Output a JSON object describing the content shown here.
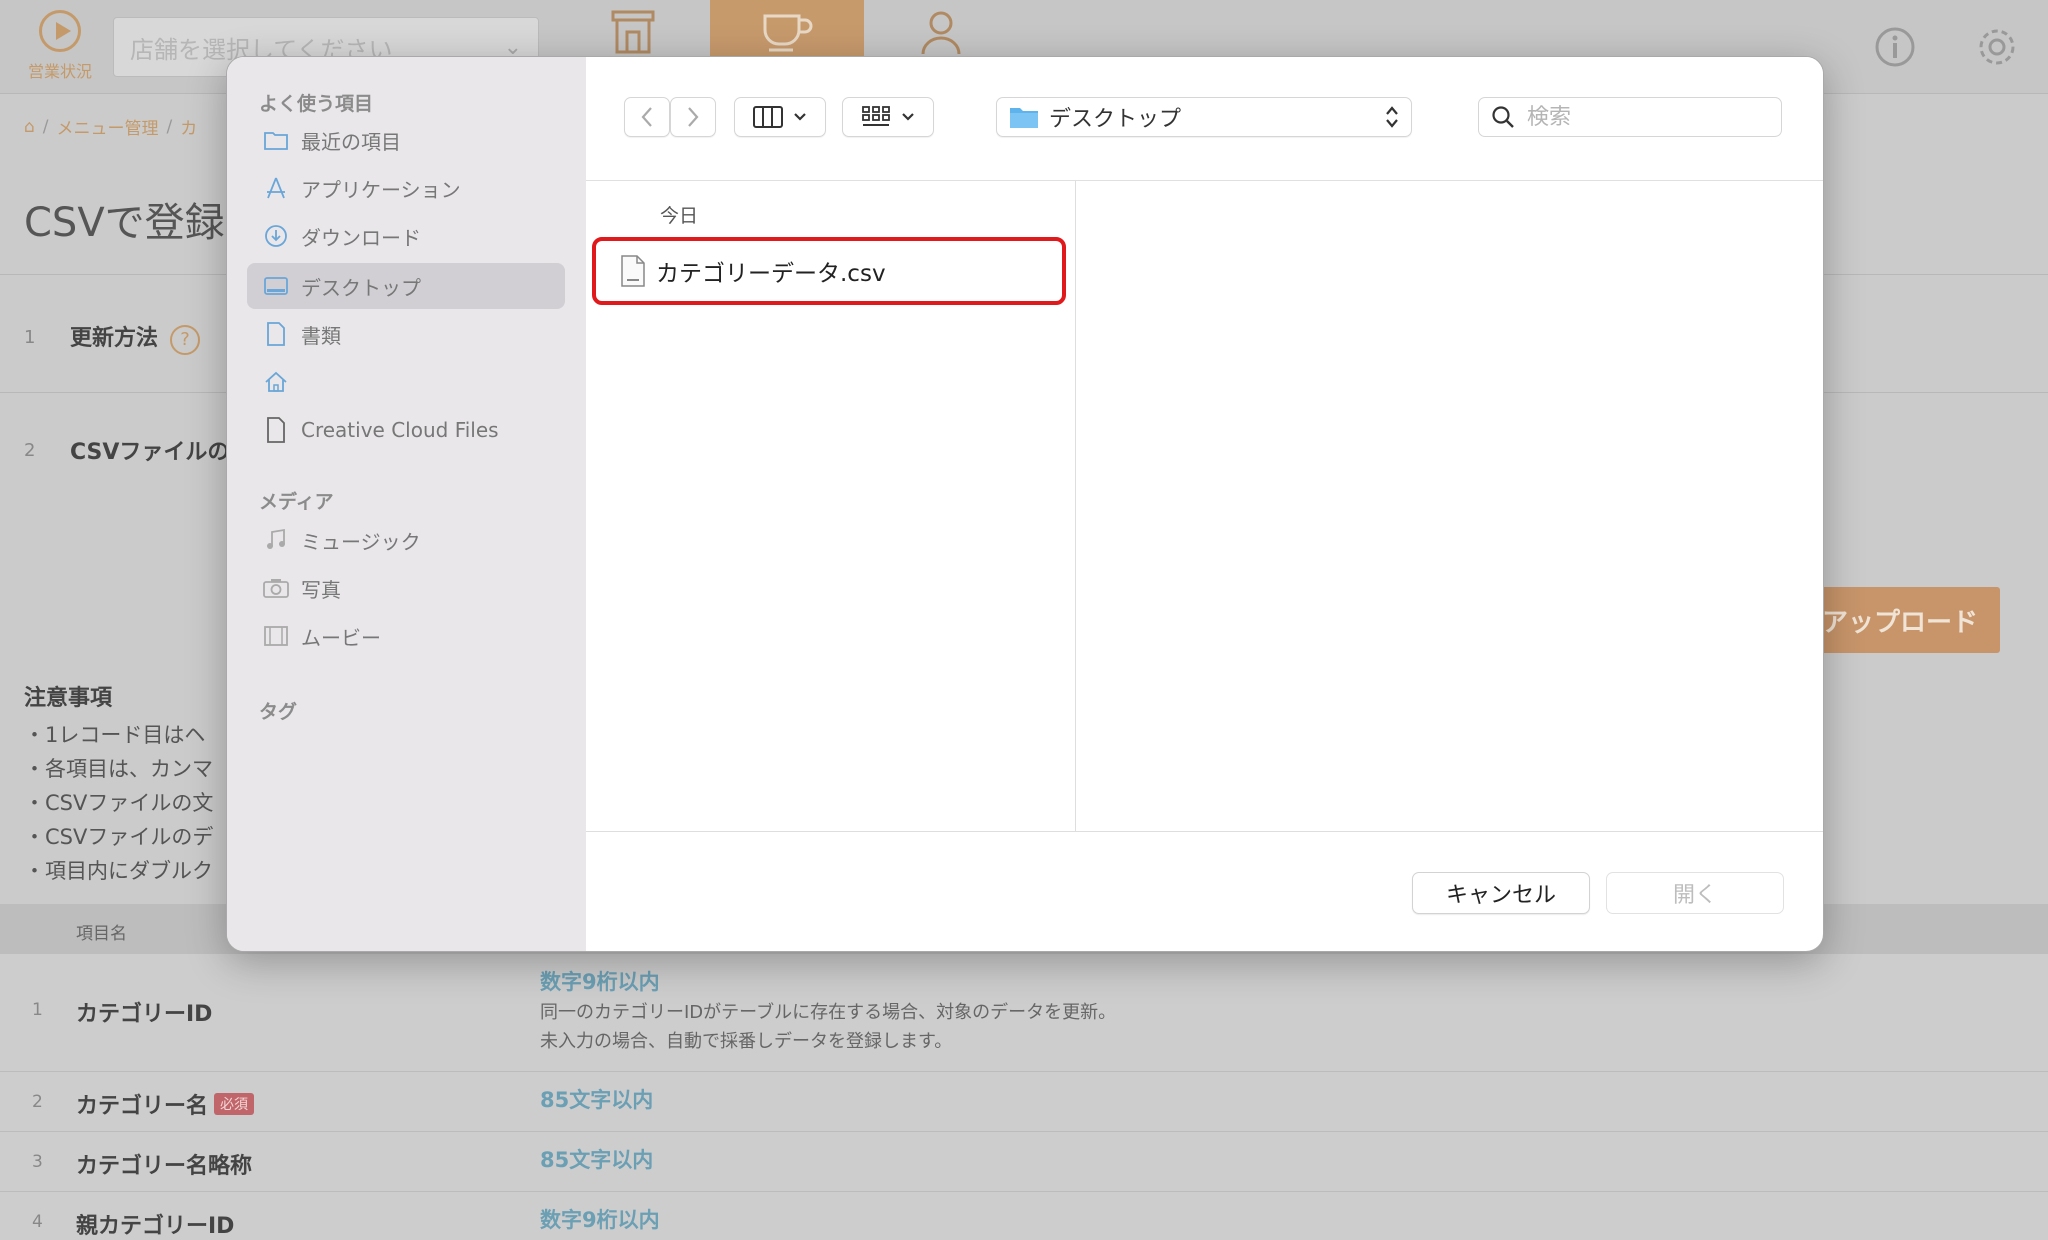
{
  "app": {
    "status_label": "営業状況",
    "store_placeholder": "店舗を選択してください",
    "breadcrumb": [
      "メニュー管理",
      "カ"
    ],
    "page_title": "CSVで登録",
    "steps": [
      {
        "num": "1",
        "label": "更新方法",
        "help": "?"
      },
      {
        "num": "2",
        "label": "CSVファイルの"
      }
    ],
    "upload_label": "アップロード",
    "notes_title": "注意事項",
    "notes": [
      "・1レコード目はヘ",
      "・各項目は、カンマ",
      "・CSVファイルの文",
      "・CSVファイルのデ",
      "・項目内にダブルク"
    ],
    "table_header": "項目名",
    "rows": [
      {
        "num": "1",
        "name": "カテゴリーID",
        "rule": "数字9桁以内",
        "desc1": "同一のカテゴリーIDがテーブルに存在する場合、対象のデータを更新。",
        "desc2": "未入力の場合、自動で採番しデータを登録します。"
      },
      {
        "num": "2",
        "name": "カテゴリー名",
        "badge": "必須",
        "rule": "85文字以内"
      },
      {
        "num": "3",
        "name": "カテゴリー名略称",
        "rule": "85文字以内"
      },
      {
        "num": "4",
        "name": "親カテゴリーID",
        "rule": "数字9桁以内"
      }
    ]
  },
  "dialog": {
    "sidebar": {
      "favorites_title": "よく使う項目",
      "favorites": [
        {
          "label": "最近の項目",
          "icon": "folder-icon"
        },
        {
          "label": "アプリケーション",
          "icon": "apps-icon"
        },
        {
          "label": "ダウンロード",
          "icon": "download-icon"
        },
        {
          "label": "デスクトップ",
          "icon": "desktop-icon",
          "selected": true
        },
        {
          "label": "書類",
          "icon": "document-icon"
        },
        {
          "label": "",
          "icon": "home-icon"
        },
        {
          "label": "Creative Cloud Files",
          "icon": "file-icon"
        }
      ],
      "media_title": "メディア",
      "media": [
        {
          "label": "ミュージック",
          "icon": "music-icon"
        },
        {
          "label": "写真",
          "icon": "camera-icon"
        },
        {
          "label": "ムービー",
          "icon": "film-icon"
        }
      ],
      "tags_title": "タグ"
    },
    "location": "デスクトップ",
    "search_placeholder": "検索",
    "group_label": "今日",
    "file_name": "カテゴリーデータ.csv",
    "cancel_label": "キャンセル",
    "open_label": "開く",
    "colors": {
      "highlight": "#e0191c",
      "accent": "#c79a6c"
    }
  }
}
